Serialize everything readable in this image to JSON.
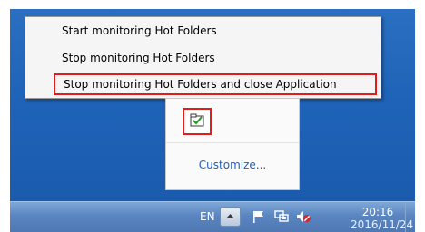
{
  "context_menu": {
    "items": [
      {
        "label": "Start monitoring Hot Folders"
      },
      {
        "label": "Stop monitoring Hot Folders"
      },
      {
        "label": "Stop monitoring Hot Folders and close Application"
      }
    ]
  },
  "tray_popup": {
    "customize_label": "Customize...",
    "app_icon": "hot-folder-check-icon"
  },
  "taskbar": {
    "language": "EN",
    "icons": [
      "show-hidden-icons-up-arrow",
      "action-center-flag-icon",
      "network-icon",
      "volume-muted-icon"
    ],
    "time": "20:16",
    "date": "2016/11/24"
  },
  "colors": {
    "highlight_border": "#e21b1b",
    "link": "#1f5fbf",
    "desktop": "#1f63b8"
  }
}
